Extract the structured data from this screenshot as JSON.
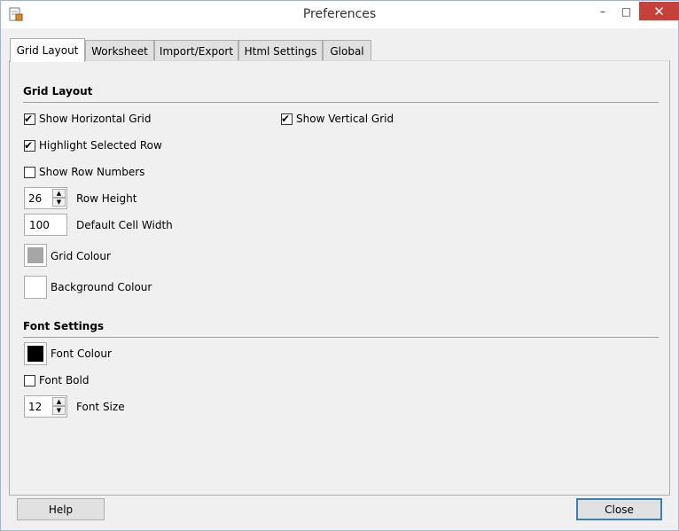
{
  "window": {
    "title": "Preferences",
    "controls": {
      "minimize": "–",
      "maximize": "□",
      "close": "✕"
    },
    "colors": {
      "close_bg": "#c7413b",
      "accent": "#3c7fb1"
    }
  },
  "tabs": [
    {
      "label": "Grid Layout",
      "active": true
    },
    {
      "label": "Worksheet",
      "active": false
    },
    {
      "label": "Import/Export",
      "active": false
    },
    {
      "label": "Html Settings",
      "active": false
    },
    {
      "label": "Global",
      "active": false
    }
  ],
  "grid_layout": {
    "section_title": "Grid Layout",
    "show_horizontal_grid": {
      "label": "Show Horizontal Grid",
      "checked": true
    },
    "show_vertical_grid": {
      "label": "Show Vertical Grid",
      "checked": true
    },
    "highlight_selected_row": {
      "label": "Highlight Selected Row",
      "checked": true
    },
    "show_row_numbers": {
      "label": "Show Row Numbers",
      "checked": false
    },
    "row_height": {
      "label": "Row Height",
      "value": "26"
    },
    "default_cell_width": {
      "label": "Default Cell Width",
      "value": "100"
    },
    "grid_colour": {
      "label": "Grid Colour",
      "color": "#a6a6a6"
    },
    "background_colour": {
      "label": "Background Colour",
      "color": "#ffffff"
    }
  },
  "font_settings": {
    "section_title": "Font Settings",
    "font_colour": {
      "label": "Font Colour",
      "color": "#000000"
    },
    "font_bold": {
      "label": "Font Bold",
      "checked": false
    },
    "font_size": {
      "label": "Font Size",
      "value": "12"
    }
  },
  "buttons": {
    "help": "Help",
    "close": "Close"
  },
  "icons": {
    "check": "✔",
    "spin_up": "▲",
    "spin_down": "▼"
  }
}
